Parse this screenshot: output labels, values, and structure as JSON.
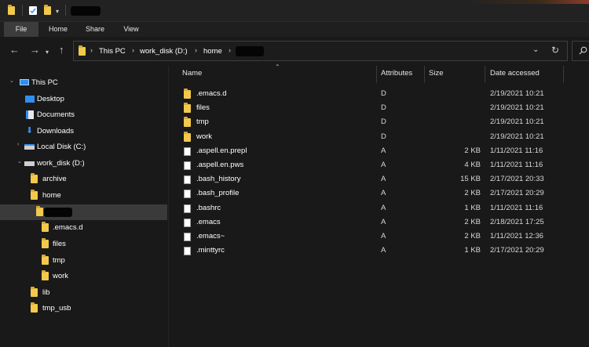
{
  "window": {
    "quick_access_icons": [
      "folder-icon",
      "properties-icon",
      "new-folder-icon",
      "customize-chevron-icon"
    ],
    "title_redacted": true
  },
  "ribbon": {
    "tabs": [
      {
        "label": "File",
        "active": true
      },
      {
        "label": "Home",
        "active": false
      },
      {
        "label": "Share",
        "active": false
      },
      {
        "label": "View",
        "active": false
      }
    ]
  },
  "address": {
    "crumbs": [
      "This PC",
      "work_disk (D:)",
      "home"
    ],
    "last_crumb_redacted": true
  },
  "nav": {
    "this_pc": "This PC",
    "desktop": "Desktop",
    "documents": "Documents",
    "downloads": "Downloads",
    "local_disk": "Local Disk (C:)",
    "work_disk": "work_disk (D:)",
    "archive": "archive",
    "home": "home",
    "sub_emacs": ".emacs.d",
    "sub_files": "files",
    "sub_tmp": "tmp",
    "sub_work": "work",
    "lib": "lib",
    "tmp_usb": "tmp_usb"
  },
  "columns": {
    "name": "Name",
    "attributes": "Attributes",
    "size": "Size",
    "date": "Date accessed"
  },
  "files": [
    {
      "name": ".emacs.d",
      "type": "folder",
      "attr": "D",
      "size": "",
      "date": "2/19/2021 10:21"
    },
    {
      "name": "files",
      "type": "folder",
      "attr": "D",
      "size": "",
      "date": "2/19/2021 10:21"
    },
    {
      "name": "tmp",
      "type": "folder",
      "attr": "D",
      "size": "",
      "date": "2/19/2021 10:21"
    },
    {
      "name": "work",
      "type": "folder",
      "attr": "D",
      "size": "",
      "date": "2/19/2021 10:21"
    },
    {
      "name": ".aspell.en.prepl",
      "type": "file",
      "attr": "A",
      "size": "2 KB",
      "date": "1/11/2021 11:16"
    },
    {
      "name": ".aspell.en.pws",
      "type": "file",
      "attr": "A",
      "size": "4 KB",
      "date": "1/11/2021 11:16"
    },
    {
      "name": ".bash_history",
      "type": "file",
      "attr": "A",
      "size": "15 KB",
      "date": "2/17/2021 20:33"
    },
    {
      "name": ".bash_profile",
      "type": "file",
      "attr": "A",
      "size": "2 KB",
      "date": "2/17/2021 20:29"
    },
    {
      "name": ".bashrc",
      "type": "file",
      "attr": "A",
      "size": "1 KB",
      "date": "1/11/2021 11:16"
    },
    {
      "name": ".emacs",
      "type": "file",
      "attr": "A",
      "size": "2 KB",
      "date": "2/18/2021 17:25"
    },
    {
      "name": ".emacs~",
      "type": "file",
      "attr": "A",
      "size": "2 KB",
      "date": "1/11/2021 12:36"
    },
    {
      "name": ".minttyrc",
      "type": "file",
      "attr": "A",
      "size": "1 KB",
      "date": "2/17/2021 20:29"
    }
  ],
  "colors": {
    "background": "#191919",
    "folder": "#f2c94c",
    "selected_row": "#3a3a3a",
    "drive_blue": "#2f8ff0"
  }
}
